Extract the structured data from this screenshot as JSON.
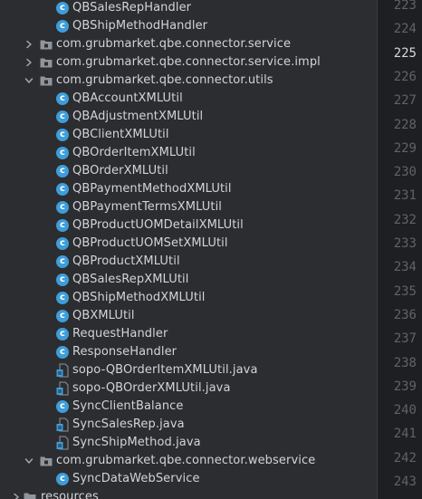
{
  "tree": {
    "items": [
      {
        "type": "class",
        "label": "QBSalesRepHandler",
        "level": 2
      },
      {
        "type": "class",
        "label": "QBShipMethodHandler",
        "level": 2
      },
      {
        "type": "package",
        "label": "com.grubmarket.qbe.connector.service",
        "level": 1,
        "expanded": false
      },
      {
        "type": "package",
        "label": "com.grubmarket.qbe.connector.service.impl",
        "level": 1,
        "expanded": false
      },
      {
        "type": "package",
        "label": "com.grubmarket.qbe.connector.utils",
        "level": 1,
        "expanded": true
      },
      {
        "type": "class",
        "label": "QBAccountXMLUtil",
        "level": 2
      },
      {
        "type": "class",
        "label": "QBAdjustmentXMLUtil",
        "level": 2
      },
      {
        "type": "class",
        "label": "QBClientXMLUtil",
        "level": 2
      },
      {
        "type": "class",
        "label": "QBOrderItemXMLUtil",
        "level": 2
      },
      {
        "type": "class",
        "label": "QBOrderXMLUtil",
        "level": 2
      },
      {
        "type": "class",
        "label": "QBPaymentMethodXMLUtil",
        "level": 2
      },
      {
        "type": "class",
        "label": "QBPaymentTermsXMLUtil",
        "level": 2
      },
      {
        "type": "class",
        "label": "QBProductUOMDetailXMLUtil",
        "level": 2
      },
      {
        "type": "class",
        "label": "QBProductUOMSetXMLUtil",
        "level": 2
      },
      {
        "type": "class",
        "label": "QBProductXMLUtil",
        "level": 2
      },
      {
        "type": "class",
        "label": "QBSalesRepXMLUtil",
        "level": 2
      },
      {
        "type": "class",
        "label": "QBShipMethodXMLUtil",
        "level": 2
      },
      {
        "type": "class",
        "label": "QBXMLUtil",
        "level": 2
      },
      {
        "type": "class",
        "label": "RequestHandler",
        "level": 2
      },
      {
        "type": "class",
        "label": "ResponseHandler",
        "level": 2
      },
      {
        "type": "java-file",
        "label": "sopo-QBOrderItemXMLUtil.java",
        "level": 2
      },
      {
        "type": "java-file",
        "label": "sopo-QBOrderXMLUtil.java",
        "level": 2
      },
      {
        "type": "class",
        "label": "SyncClientBalance",
        "level": 2
      },
      {
        "type": "java-file",
        "label": "SyncSalesRep.java",
        "level": 2
      },
      {
        "type": "java-file",
        "label": "SyncShipMethod.java",
        "level": 2
      },
      {
        "type": "package",
        "label": "com.grubmarket.qbe.connector.webservice",
        "level": 1,
        "expanded": true
      },
      {
        "type": "class",
        "label": "SyncDataWebService",
        "level": 2
      },
      {
        "type": "folder",
        "label": "resources",
        "level": 0,
        "expanded": false
      }
    ]
  },
  "gutter": {
    "line_numbers": [
      "223",
      "224",
      "225",
      "226",
      "227",
      "228",
      "229",
      "230",
      "231",
      "232",
      "233",
      "234",
      "235",
      "236",
      "237",
      "238",
      "239",
      "240",
      "241",
      "242",
      "243"
    ],
    "current_line": "225"
  },
  "colors": {
    "tree_background": "#2b2d30",
    "gutter_background": "#1e1f22",
    "class_icon": "#3e9dd9",
    "package_icon": "#9aa0a6",
    "text": "#d1d4d9",
    "line_number": "#5f6368",
    "current_line_number": "#d6d8dc"
  },
  "icons": {
    "class": "class-c-icon",
    "package": "package-folder-icon",
    "java-file": "java-file-icon",
    "folder": "folder-icon",
    "collapsed": "chevron-right-icon",
    "expanded": "chevron-down-icon"
  }
}
